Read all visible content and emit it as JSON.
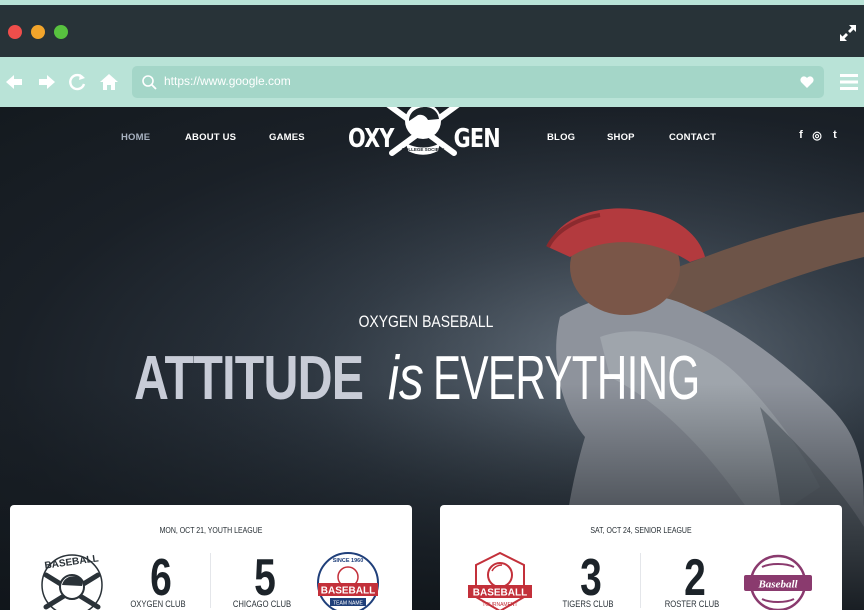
{
  "browser": {
    "url": "https://www.google.com",
    "icons": [
      "close-dot",
      "minimize-dot",
      "maximize-dot",
      "expand-icon",
      "back-arrow-icon",
      "forward-arrow-icon",
      "reload-icon",
      "home-icon",
      "search-icon",
      "heart-icon",
      "menu-icon"
    ]
  },
  "nav": {
    "home": "HOME",
    "about": "ABOUT US",
    "games": "GAMES",
    "blog": "BLOG",
    "shop": "SHOP",
    "contact": "CONTACT",
    "social": [
      "f",
      "◎",
      "t"
    ]
  },
  "logo": {
    "left": "OXY",
    "right": "GEN",
    "tagline": "COLLEGE SOCIETY"
  },
  "hero": {
    "kicker": "OXYGEN BASEBALL",
    "headline_bold": "ATTITUDE",
    "headline_italic": "is",
    "headline_rest": "EVERYTHING"
  },
  "games": [
    {
      "date": "MON, OCT 21, YOUTH LEAGUE",
      "home_team": "OXYGEN CLUB",
      "home_score": "6",
      "away_team": "CHICAGO CLUB",
      "away_score": "5",
      "home_badge_text": "BASEBALL",
      "away_badge_text": "BASEBALL",
      "away_badge_top": "SINCE 1960",
      "away_badge_bottom": "TEAM NAME"
    },
    {
      "date": "SAT, OCT 24, SENIOR LEAGUE",
      "home_team": "TIGERS CLUB",
      "home_score": "3",
      "away_team": "ROSTER CLUB",
      "away_score": "2",
      "home_badge_text": "BASEBALL",
      "home_badge_bottom": "TOURNAMENT",
      "away_badge_text": "Baseball"
    }
  ],
  "colors": {
    "chrome_dark": "#283338",
    "chrome_light": "#b9e3d7",
    "url_bar": "#a4d6c8",
    "hero_bg": "#1a2027",
    "accent_red": "#c3303a",
    "accent_navy": "#1f3f7a",
    "accent_purple": "#8a3a6e"
  }
}
